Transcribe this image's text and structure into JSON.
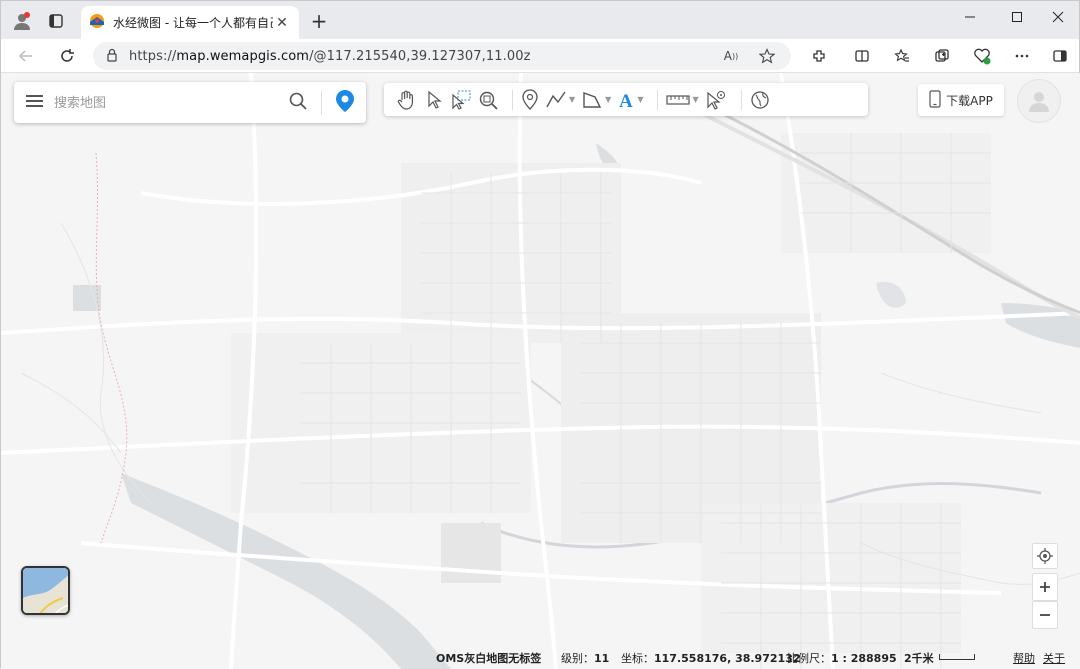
{
  "browser": {
    "tab_title": "水经微图 - 让每一个人都有自己的",
    "url_prefix": "https://",
    "url_host": "map.wemapgis.com",
    "url_rest": "/@117.215540,39.127307,11.00z",
    "tab_close_glyph": "✕",
    "new_tab_glyph": "+",
    "icons": {
      "profile": "profile-icon",
      "tab_actions": "tab-actions-icon",
      "back": "back-icon",
      "refresh": "refresh-icon",
      "site_info": "site-info-icon",
      "read_aloud": "read-aloud-icon",
      "favorite": "star-icon"
    }
  },
  "search": {
    "placeholder": "搜索地图"
  },
  "download": {
    "label": "下载APP"
  },
  "status": {
    "layer_name": "OMS灰白地图无标签",
    "level_label": "级别：",
    "level_value": "11",
    "coord_label": "坐标：",
    "coord_value": "117.558176, 38.972132",
    "scale_label": "比例尺：",
    "scale_value": "1 : 288895",
    "scalebar_label": "2千米",
    "help": "帮助",
    "about": "关于"
  },
  "colors": {
    "accent_blue": "#1e88e5",
    "map_bg": "#f5f5f5",
    "road": "#ffffff",
    "water": "#d9dde1"
  }
}
